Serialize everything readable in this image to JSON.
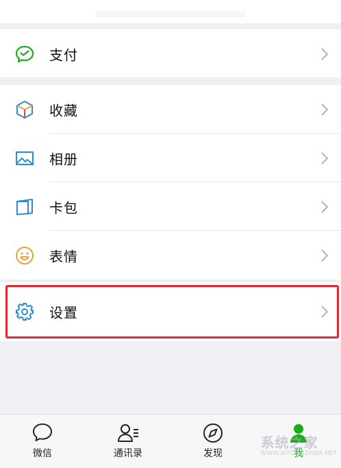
{
  "menu": {
    "pay": "支付",
    "favorites": "收藏",
    "album": "相册",
    "cards": "卡包",
    "stickers": "表情",
    "settings": "设置"
  },
  "tabs": [
    "微信",
    "通讯录",
    "发现",
    "我"
  ],
  "watermark": {
    "title": "系统之家",
    "url": "WWW.XITONGZHIJIA.NET"
  },
  "colors": {
    "accent": "#1aad19",
    "highlight": "#e3262f",
    "icon_blue": "#2b8ccf"
  }
}
